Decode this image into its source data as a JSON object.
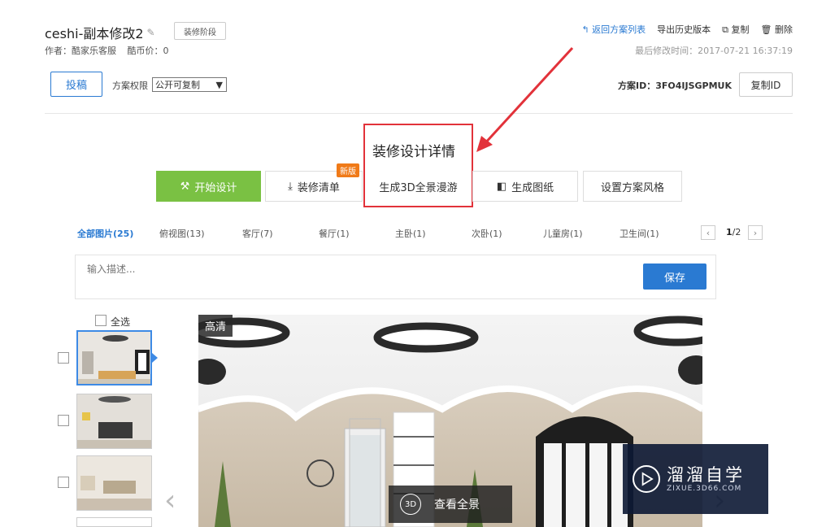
{
  "header": {
    "title": "ceshi-副本修改2",
    "stage_button": "装修阶段",
    "author": "作者：酷家乐客服",
    "coins": "酷币价：0",
    "links": {
      "back": "返回方案列表",
      "export": "导出历史版本",
      "copy": "复制",
      "delete": "删除"
    },
    "last_modified": "最后修改时间：2017-07-21 16:37:19"
  },
  "toolbar": {
    "submit": "投稿",
    "permission_label": "方案权限",
    "permission_value": "公开可复制",
    "plan_id": "方案ID：3FO4IJSGPMUK",
    "copy_id": "复制ID"
  },
  "detail": {
    "title": "装修设计详情",
    "new_badge": "新版",
    "buttons": {
      "start_design": "开始设计",
      "renovation_list": "装修清单",
      "generate_3d": "生成3D全景漫游",
      "generate_drawing": "生成图纸",
      "set_style": "设置方案风格"
    }
  },
  "tabs": [
    {
      "label": "全部图片(25)"
    },
    {
      "label": "俯视图(13)"
    },
    {
      "label": "客厅(7)"
    },
    {
      "label": "餐厅(1)"
    },
    {
      "label": "主卧(1)"
    },
    {
      "label": "次卧(1)"
    },
    {
      "label": "儿童房(1)"
    },
    {
      "label": "卫生间(1)"
    }
  ],
  "pager": {
    "current": "1",
    "total": "/2"
  },
  "description": {
    "placeholder": "输入描述...",
    "save": "保存"
  },
  "gallery": {
    "select_all": "全选",
    "hd": "高清",
    "badge_3d": "3D",
    "view_panorama": "查看全景"
  },
  "watermark": {
    "name": "溜溜自学",
    "url": "ZIXUE.3D66.COM"
  },
  "colors": {
    "accent": "#2a7ad2",
    "green": "#7ac143",
    "highlight": "#e2323a"
  }
}
